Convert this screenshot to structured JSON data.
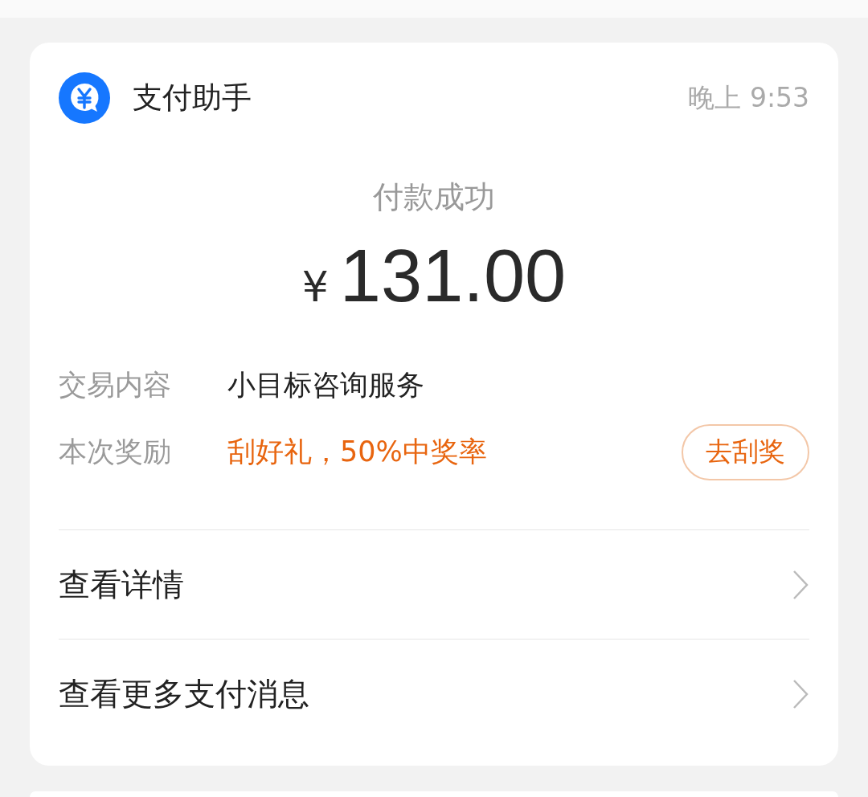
{
  "header": {
    "title": "支付助手",
    "time": "晚上 9:53"
  },
  "status": "付款成功",
  "amount": {
    "currency": "¥",
    "value": "131.00"
  },
  "info_rows": [
    {
      "kind": "plain",
      "label": "交易内容",
      "value": "小目标咨询服务"
    },
    {
      "kind": "reward",
      "label": "本次奖励",
      "value": "刮好礼，50%中奖率",
      "button": "去刮奖"
    }
  ],
  "links": [
    "查看详情",
    "查看更多支付消息"
  ]
}
